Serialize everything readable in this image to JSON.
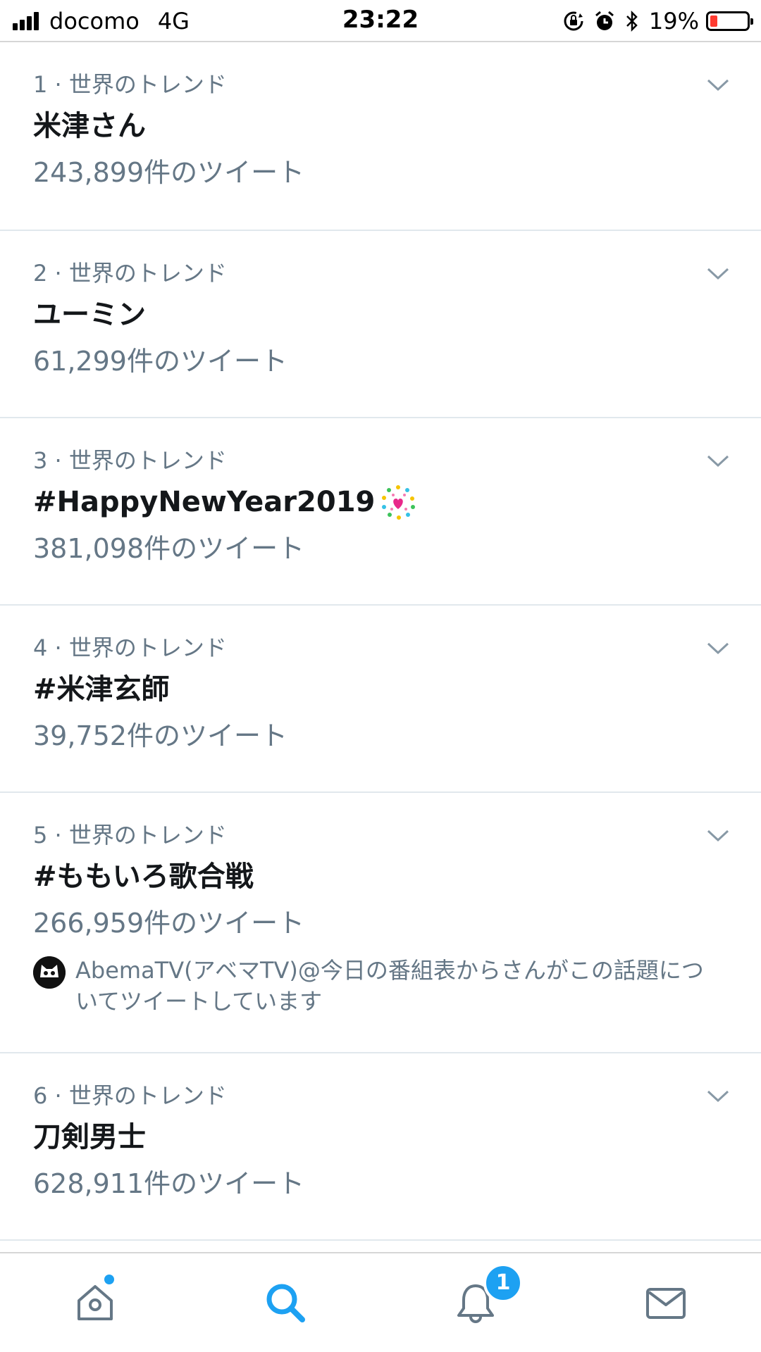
{
  "status_bar": {
    "carrier": "docomo",
    "network": "4G",
    "time": "23:22",
    "battery_percent": "19%",
    "battery_level": 0.19,
    "icons": [
      "signal-icon",
      "orientation-lock-icon",
      "alarm-icon",
      "bluetooth-icon",
      "battery-icon"
    ]
  },
  "trends": [
    {
      "meta": "1 · 世界のトレンド",
      "title": "米津さん",
      "count": "243,899件のツイート"
    },
    {
      "meta": "2 · 世界のトレンド",
      "title": "ユーミン",
      "count": "61,299件のツイート"
    },
    {
      "meta": "3 · 世界のトレンド",
      "title": "#HappyNewYear2019",
      "count": "381,098件のツイート",
      "emoji": "sparkling-heart-fireworks-icon"
    },
    {
      "meta": "4 · 世界のトレンド",
      "title": "#米津玄師",
      "count": "39,752件のツイート"
    },
    {
      "meta": "5 · 世界のトレンド",
      "title": "#ももいろ歌合戦",
      "count": "266,959件のツイート",
      "context": "AbemaTV(アベマTV)@今日の番組表からさんがこの話題についてツイートしています"
    },
    {
      "meta": "6 · 世界のトレンド",
      "title": "刀剣男士",
      "count": "628,911件のツイート"
    }
  ],
  "tab_bar": {
    "items": [
      "home-icon",
      "search-icon",
      "notifications-icon",
      "messages-icon"
    ],
    "active": "search",
    "notification_badge": "1"
  },
  "colors": {
    "accent": "#1da1f2",
    "secondary_text": "#657786",
    "primary_text": "#14171a",
    "divider": "#e1e8ed",
    "battery_low": "#ff3b30"
  }
}
